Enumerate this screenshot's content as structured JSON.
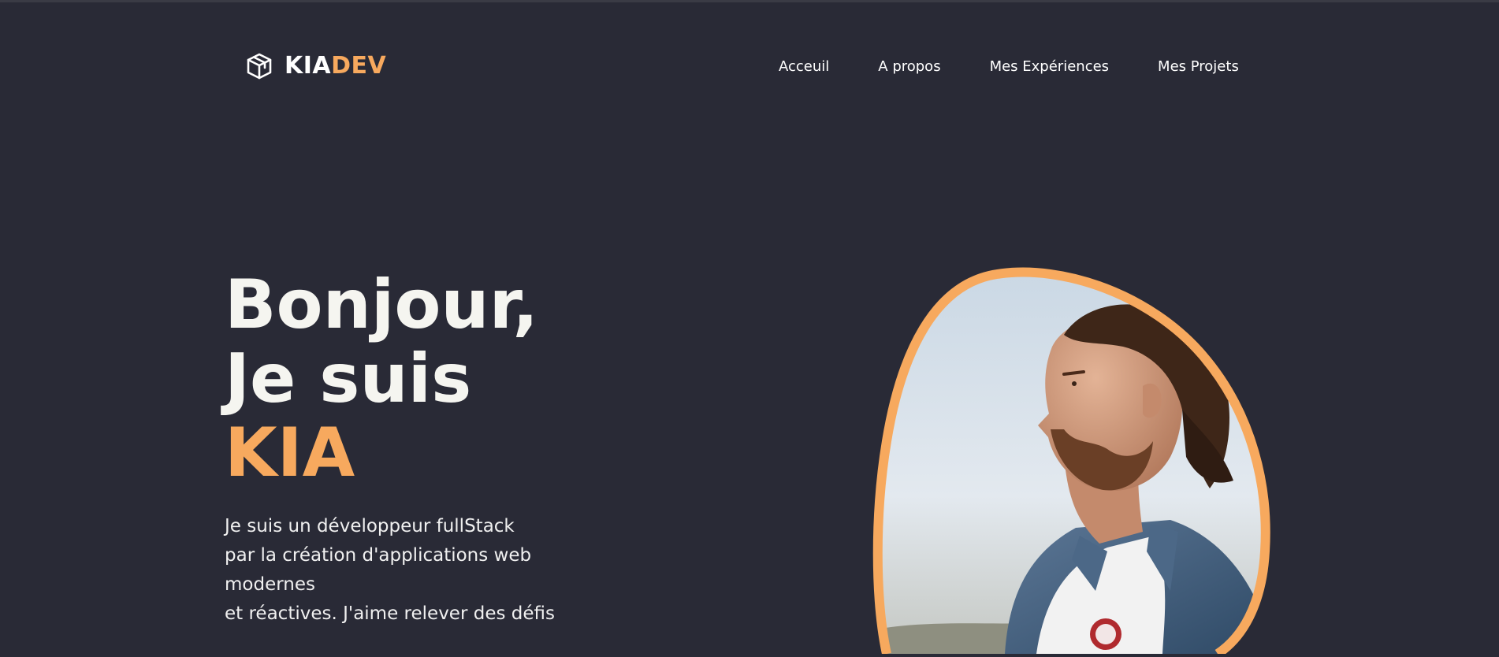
{
  "brand": {
    "part1": "KIA",
    "part2": "DEV",
    "icon": "box-icon",
    "accent_color": "#f7a95e",
    "background_color": "#292a36"
  },
  "nav": {
    "items": [
      {
        "label": "Acceuil"
      },
      {
        "label": "A propos"
      },
      {
        "label": "Mes Expériences"
      },
      {
        "label": "Mes Projets"
      }
    ]
  },
  "hero": {
    "greeting": "Bonjour,",
    "intro": "Je suis",
    "name": "KIA",
    "description_lines": [
      "Je suis un développeur fullStack",
      "par la création d'applications web",
      "modernes",
      "et réactives. J'aime relever des défis"
    ]
  }
}
